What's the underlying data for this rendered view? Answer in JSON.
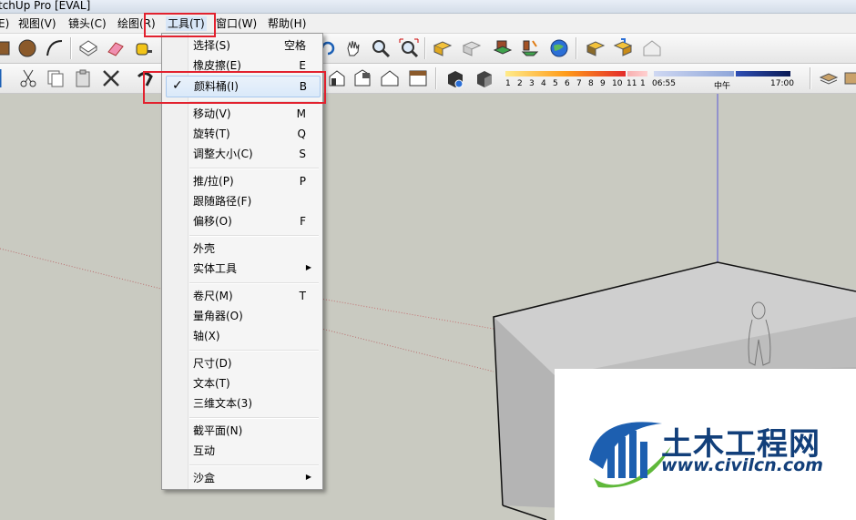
{
  "window": {
    "title": "tchUp Pro [EVAL]"
  },
  "menubar": {
    "items": [
      {
        "label": "E)"
      },
      {
        "label": "视图(V)"
      },
      {
        "label": "镜头(C)"
      },
      {
        "label": "绘图(R)"
      },
      {
        "label": "工具(T)"
      },
      {
        "label": "窗口(W)"
      },
      {
        "label": "帮助(H)"
      }
    ]
  },
  "tools_menu": {
    "items": [
      {
        "label": "选择(S)",
        "shortcut": "空格"
      },
      {
        "label": "橡皮擦(E)",
        "shortcut": "E"
      },
      {
        "label": "颜料桶(I)",
        "shortcut": "B"
      },
      {
        "label": "移动(V)",
        "shortcut": "M"
      },
      {
        "label": "旋转(T)",
        "shortcut": "Q"
      },
      {
        "label": "调整大小(C)",
        "shortcut": "S"
      },
      {
        "label": "推/拉(P)",
        "shortcut": "P"
      },
      {
        "label": "跟随路径(F)",
        "shortcut": ""
      },
      {
        "label": "偏移(O)",
        "shortcut": "F"
      },
      {
        "label": "外壳",
        "shortcut": ""
      },
      {
        "label": "实体工具",
        "shortcut": ""
      },
      {
        "label": "卷尺(M)",
        "shortcut": "T"
      },
      {
        "label": "量角器(O)",
        "shortcut": ""
      },
      {
        "label": "轴(X)",
        "shortcut": ""
      },
      {
        "label": "尺寸(D)",
        "shortcut": ""
      },
      {
        "label": "文本(T)",
        "shortcut": ""
      },
      {
        "label": "三维文本(3)",
        "shortcut": ""
      },
      {
        "label": "截平面(N)",
        "shortcut": ""
      },
      {
        "label": "互动",
        "shortcut": ""
      },
      {
        "label": "沙盒",
        "shortcut": ""
      }
    ],
    "checkmark": "✓",
    "submenu_arrow": "▶"
  },
  "shadow_bar": {
    "months": [
      "1",
      "2",
      "3",
      "4",
      "5",
      "6",
      "7",
      "8",
      "9",
      "10",
      "11",
      "1"
    ],
    "time_start": "06:55",
    "time_mid": "中午",
    "time_end": "17:00"
  },
  "watermark": {
    "text_cn": "土木工程网",
    "url": "www.civilcn.com"
  },
  "colors": {
    "highlight_border": "#e2212e",
    "brand_blue": "#123f7a",
    "viewport_bg": "#c9cac1"
  },
  "icons": [
    "rectangle-icon",
    "circle-icon",
    "arc-icon",
    "make-component-icon",
    "eraser-icon",
    "tape-measure-icon",
    "orbit-icon",
    "pan-icon",
    "zoom-icon",
    "zoom-extents-icon",
    "get-models-icon",
    "share-model-icon",
    "warehouse-icon",
    "place-model-icon",
    "google-earth-icon",
    "components-icon",
    "extension-icon",
    "scissors-icon",
    "copy-icon",
    "paste-icon",
    "delete-icon",
    "undo-icon",
    "iso-view-icon",
    "front-view-icon",
    "side-view-icon",
    "shadow-icon",
    "fog-icon"
  ]
}
